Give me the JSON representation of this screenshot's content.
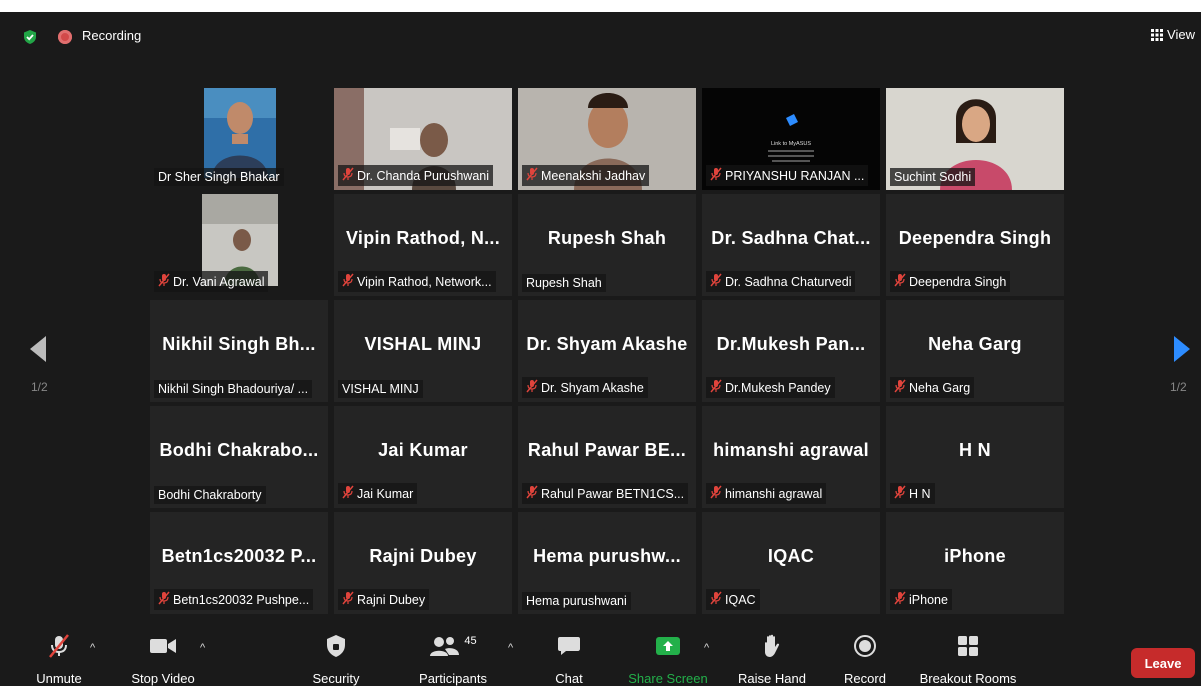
{
  "topbar": {
    "recording_label": "Recording",
    "view_label": "View"
  },
  "pager": {
    "left": "1/2",
    "right": "1/2"
  },
  "tiles": [
    {
      "big": "",
      "label": "Dr Sher Singh Bhakar",
      "muted": false,
      "video": "person1",
      "active": true
    },
    {
      "big": "",
      "label": "Dr. Chanda Purushwani",
      "muted": true,
      "video": "person2"
    },
    {
      "big": "",
      "label": "Meenakshi Jadhav",
      "muted": true,
      "video": "person3"
    },
    {
      "big": "",
      "label": "PRIYANSHU RANJAN ...",
      "muted": true,
      "video": "screen"
    },
    {
      "big": "",
      "label": "Suchint Sodhi",
      "muted": false,
      "video": "person4"
    },
    {
      "big": "",
      "label": "Dr. Vani Agrawal",
      "muted": true,
      "video": "person5"
    },
    {
      "big": "Vipin Rathod, N...",
      "label": "Vipin Rathod, Network...",
      "muted": true
    },
    {
      "big": "Rupesh Shah",
      "label": "Rupesh Shah",
      "muted": false
    },
    {
      "big": "Dr. Sadhna Chat...",
      "label": "Dr. Sadhna Chaturvedi",
      "muted": true
    },
    {
      "big": "Deependra Singh",
      "label": "Deependra Singh",
      "muted": true
    },
    {
      "big": "Nikhil Singh Bh...",
      "label": "Nikhil Singh Bhadouriya/ ...",
      "muted": false
    },
    {
      "big": "VISHAL MINJ",
      "label": "VISHAL MINJ",
      "muted": false
    },
    {
      "big": "Dr. Shyam Akashe",
      "label": "Dr. Shyam Akashe",
      "muted": true
    },
    {
      "big": "Dr.Mukesh Pan...",
      "label": "Dr.Mukesh Pandey",
      "muted": true
    },
    {
      "big": "Neha Garg",
      "label": "Neha Garg",
      "muted": true
    },
    {
      "big": "Bodhi Chakrabo...",
      "label": "Bodhi Chakraborty",
      "muted": false
    },
    {
      "big": "Jai Kumar",
      "label": "Jai Kumar",
      "muted": true
    },
    {
      "big": "Rahul Pawar BE...",
      "label": "Rahul Pawar BETN1CS...",
      "muted": true
    },
    {
      "big": "himanshi agrawal",
      "label": "himanshi agrawal",
      "muted": true
    },
    {
      "big": "H N",
      "label": "H N",
      "muted": true
    },
    {
      "big": "Betn1cs20032 P...",
      "label": "Betn1cs20032 Pushpe...",
      "muted": true
    },
    {
      "big": "Rajni Dubey",
      "label": "Rajni Dubey",
      "muted": true
    },
    {
      "big": "Hema purushw...",
      "label": "Hema purushwani",
      "muted": false
    },
    {
      "big": "IQAC",
      "label": "IQAC",
      "muted": true
    },
    {
      "big": "iPhone",
      "label": "iPhone",
      "muted": true
    }
  ],
  "screen_text": {
    "line1": "Link to MyASUS",
    "line2": "Mobile"
  },
  "toolbar": {
    "unmute": "Unmute",
    "stop_video": "Stop Video",
    "security": "Security",
    "participants": "Participants",
    "participants_count": "45",
    "chat": "Chat",
    "share_screen": "Share Screen",
    "raise_hand": "Raise Hand",
    "record": "Record",
    "breakout_rooms": "Breakout Rooms",
    "leave": "Leave"
  },
  "colors": {
    "share_green": "#23b04a",
    "leave_red": "#c62b2b",
    "active_border": "#d4e87a",
    "mute_red": "#e0443c"
  }
}
